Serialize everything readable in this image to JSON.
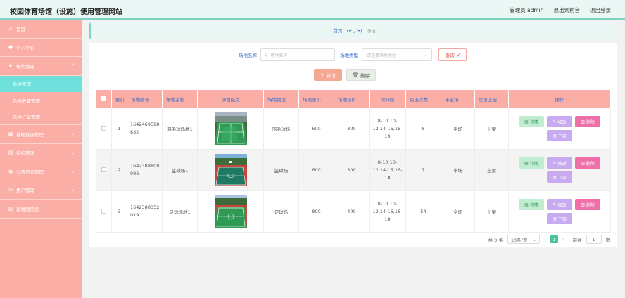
{
  "header": {
    "title": "校园体育场馆（设施）使用管理网站",
    "user": "管理员 admin",
    "back": "退出到前台",
    "logout": "退出登录"
  },
  "sidebar": {
    "items": [
      {
        "label": "首页",
        "icon": "home-icon"
      },
      {
        "label": "个人中心",
        "icon": "user-icon"
      },
      {
        "label": "场地管理",
        "icon": "pin-icon"
      },
      {
        "label": "场地管理",
        "sub": true,
        "active": true
      },
      {
        "label": "场地收藏管理",
        "sub": true
      },
      {
        "label": "场地订单管理",
        "sub": true
      },
      {
        "label": "基础数据管理",
        "icon": "grid-icon"
      },
      {
        "label": "论坛管理",
        "icon": "chat-icon"
      },
      {
        "label": "公告信息管理",
        "icon": "bell-icon"
      },
      {
        "label": "用户管理",
        "icon": "mail-icon"
      },
      {
        "label": "轮播图信息",
        "icon": "chart-icon"
      }
    ]
  },
  "breadcrumb": {
    "home": "首页",
    "face": "(•'◡'•)",
    "current": "场地"
  },
  "search": {
    "name_label": "场地名称",
    "name_placeholder": "场地名称",
    "type_label": "场地类型",
    "type_placeholder": "请选择场地类型",
    "query_label": "查询"
  },
  "actions": {
    "add": "新增",
    "delete": "删除"
  },
  "table": {
    "headers": [
      "索引",
      "场地编号",
      "场地名称",
      "场地照片",
      "场地类型",
      "场地原价",
      "场地现价",
      "时间段",
      "点击次数",
      "半全场",
      "是否上架",
      "操作"
    ],
    "rows": [
      {
        "index": "1",
        "code": "1642469598832",
        "name": "羽毛球场地1",
        "photo": "badminton-court",
        "type": "羽毛球场",
        "orig": "600",
        "now": "300",
        "time": "8-10,10-12,14-16,16-19",
        "clicks": "8",
        "half": "半场",
        "shelf": "上架"
      },
      {
        "index": "2",
        "code": "1642388800986",
        "name": "篮球场1",
        "photo": "basketball-court",
        "type": "篮球场",
        "orig": "600",
        "now": "300",
        "time": "8-10,10-12,14-16,16-18",
        "clicks": "7",
        "half": "半场",
        "shelf": "上架"
      },
      {
        "index": "3",
        "code": "1642388352019",
        "name": "足球场地1",
        "photo": "football-court",
        "type": "足球场",
        "orig": "800",
        "now": "400",
        "time": "8-10,10-12,14-16,16-18",
        "clicks": "54",
        "half": "全场",
        "shelf": "上架"
      }
    ],
    "ops": {
      "detail": "详情",
      "edit": "修改",
      "del": "删除",
      "down": "下架"
    }
  },
  "pager": {
    "total": "共 3 条",
    "size": "10条/页",
    "page": "1",
    "goto_label": "前往",
    "goto_value": "1",
    "page_suffix": "页"
  },
  "colors": {
    "sidebar": "#fbaea5",
    "active": "#6fe0dc",
    "accent": "#3a6cc8",
    "pager": "#45c39c"
  }
}
